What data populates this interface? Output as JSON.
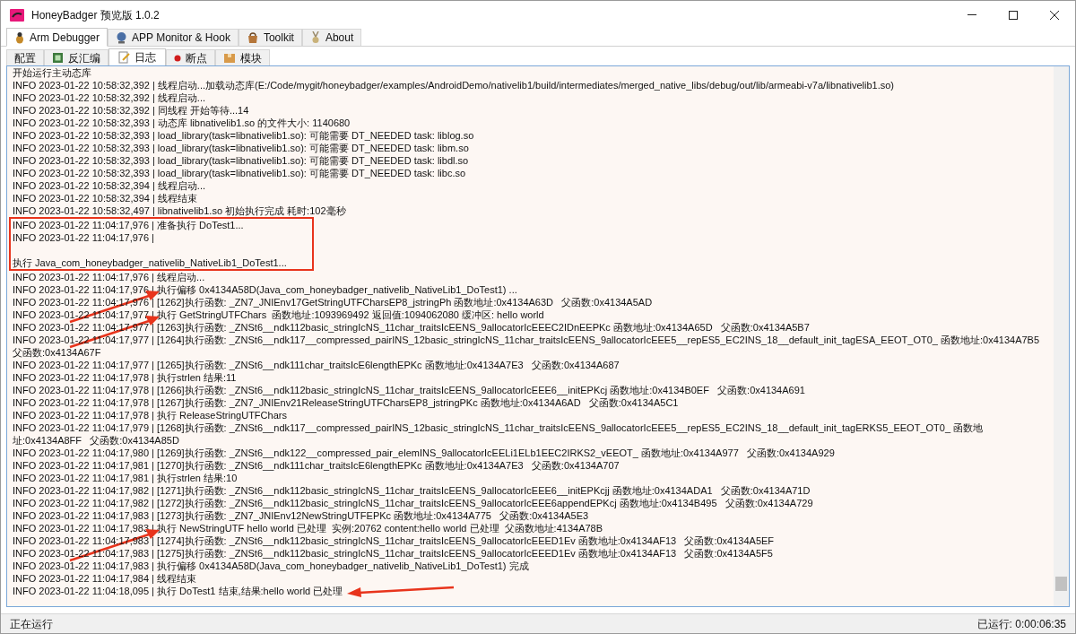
{
  "window": {
    "title": "HoneyBadger 预览版 1.0.2"
  },
  "main_tabs": [
    {
      "label": "Arm Debugger",
      "selected": true
    },
    {
      "label": "APP Monitor & Hook",
      "selected": false
    },
    {
      "label": "Toolkit",
      "selected": false
    },
    {
      "label": "About",
      "selected": false
    }
  ],
  "sub_tabs": [
    {
      "label": "配置",
      "selected": false
    },
    {
      "label": "反汇编",
      "selected": false
    },
    {
      "label": "日志",
      "selected": true
    },
    {
      "label": "断点",
      "selected": false
    },
    {
      "label": "模块",
      "selected": false
    }
  ],
  "log": [
    {
      "text": "开始运行主动态库",
      "highlighted": false,
      "arrow_from_left": false,
      "arrow_from_right": false
    },
    {
      "text": "INFO 2023-01-22 10:58:32,392 | 线程启动...加载动态库(E:/Code/mygit/honeybadger/examples/AndroidDemo/nativelib1/build/intermediates/merged_native_libs/debug/out/lib/armeabi-v7a/libnativelib1.so)",
      "highlighted": false,
      "arrow_from_left": false,
      "arrow_from_right": false
    },
    {
      "text": "INFO 2023-01-22 10:58:32,392 | 线程启动...",
      "highlighted": false,
      "arrow_from_left": false,
      "arrow_from_right": false
    },
    {
      "text": "INFO 2023-01-22 10:58:32,392 | 同线程 开始等待...14",
      "highlighted": false,
      "arrow_from_left": false,
      "arrow_from_right": false
    },
    {
      "text": "INFO 2023-01-22 10:58:32,393 | 动态库 libnativelib1.so 的文件大小: 1140680",
      "highlighted": false,
      "arrow_from_left": false,
      "arrow_from_right": false
    },
    {
      "text": "INFO 2023-01-22 10:58:32,393 | load_library(task=libnativelib1.so): 可能需要 DT_NEEDED task: liblog.so",
      "highlighted": false,
      "arrow_from_left": false,
      "arrow_from_right": false
    },
    {
      "text": "INFO 2023-01-22 10:58:32,393 | load_library(task=libnativelib1.so): 可能需要 DT_NEEDED task: libm.so",
      "highlighted": false,
      "arrow_from_left": false,
      "arrow_from_right": false
    },
    {
      "text": "INFO 2023-01-22 10:58:32,393 | load_library(task=libnativelib1.so): 可能需要 DT_NEEDED task: libdl.so",
      "highlighted": false,
      "arrow_from_left": false,
      "arrow_from_right": false
    },
    {
      "text": "INFO 2023-01-22 10:58:32,393 | load_library(task=libnativelib1.so): 可能需要 DT_NEEDED task: libc.so",
      "highlighted": false,
      "arrow_from_left": false,
      "arrow_from_right": false
    },
    {
      "text": "INFO 2023-01-22 10:58:32,394 | 线程启动...",
      "highlighted": false,
      "arrow_from_left": false,
      "arrow_from_right": false
    },
    {
      "text": "INFO 2023-01-22 10:58:32,394 | 线程结束",
      "highlighted": false,
      "arrow_from_left": false,
      "arrow_from_right": false
    },
    {
      "text": "INFO 2023-01-22 10:58:32,497 | libnativelib1.so 初始执行完成 耗时:102毫秒",
      "highlighted": false,
      "arrow_from_left": false,
      "arrow_from_right": false
    },
    {
      "text": "INFO 2023-01-22 11:04:17,976 | 准备执行 DoTest1...",
      "highlighted": true,
      "arrow_from_left": false,
      "arrow_from_right": false
    },
    {
      "text": "INFO 2023-01-22 11:04:17,976 |\n\n执行 Java_com_honeybadger_nativelib_NativeLib1_DoTest1...",
      "highlighted": true,
      "arrow_from_left": false,
      "arrow_from_right": false
    },
    {
      "text": "INFO 2023-01-22 11:04:17,976 | 线程启动...",
      "highlighted": false,
      "arrow_from_left": false,
      "arrow_from_right": false
    },
    {
      "text": "INFO 2023-01-22 11:04:17,976 | 执行偏移 0x4134A58D(Java_com_honeybadger_nativelib_NativeLib1_DoTest1) ...",
      "highlighted": false,
      "arrow_from_left": true,
      "arrow_from_right": false
    },
    {
      "text": "INFO 2023-01-22 11:04:17,976 | [1262]执行函数: _ZN7_JNIEnv17GetStringUTFCharsEP8_jstringPh 函数地址:0x4134A63D   父函数:0x4134A5AD",
      "highlighted": false,
      "arrow_from_left": false,
      "arrow_from_right": false
    },
    {
      "text": "INFO 2023-01-22 11:04:17,977 | 执行 GetStringUTFChars  函数地址:1093969492 返回值:1094062080 缓冲区: hello world",
      "highlighted": false,
      "arrow_from_left": true,
      "arrow_from_right": false
    },
    {
      "text": "INFO 2023-01-22 11:04:17,977 | [1263]执行函数: _ZNSt6__ndk112basic_stringIcNS_11char_traitsIcEENS_9allocatorIcEEEC2IDnEEPKc 函数地址:0x4134A65D   父函数:0x4134A5B7",
      "highlighted": false,
      "arrow_from_left": false,
      "arrow_from_right": false
    },
    {
      "text": "INFO 2023-01-22 11:04:17,977 | [1264]执行函数: _ZNSt6__ndk117__compressed_pairINS_12basic_stringIcNS_11char_traitsIcEENS_9allocatorIcEEE5__repES5_EC2INS_18__default_init_tagESA_EEOT_OT0_ 函数地址:0x4134A7B5   父函数:0x4134A67F",
      "highlighted": false,
      "arrow_from_left": false,
      "arrow_from_right": false
    },
    {
      "text": "INFO 2023-01-22 11:04:17,977 | [1265]执行函数: _ZNSt6__ndk111char_traitsIcE6lengthEPKc 函数地址:0x4134A7E3   父函数:0x4134A687",
      "highlighted": false,
      "arrow_from_left": false,
      "arrow_from_right": false
    },
    {
      "text": "INFO 2023-01-22 11:04:17,978 | 执行strlen 结果:11",
      "highlighted": false,
      "arrow_from_left": false,
      "arrow_from_right": false
    },
    {
      "text": "INFO 2023-01-22 11:04:17,978 | [1266]执行函数: _ZNSt6__ndk112basic_stringIcNS_11char_traitsIcEENS_9allocatorIcEEE6__initEPKcj 函数地址:0x4134B0EF   父函数:0x4134A691",
      "highlighted": false,
      "arrow_from_left": false,
      "arrow_from_right": false
    },
    {
      "text": "INFO 2023-01-22 11:04:17,978 | [1267]执行函数: _ZN7_JNIEnv21ReleaseStringUTFCharsEP8_jstringPKc 函数地址:0x4134A6AD   父函数:0x4134A5C1",
      "highlighted": false,
      "arrow_from_left": false,
      "arrow_from_right": false
    },
    {
      "text": "INFO 2023-01-22 11:04:17,978 | 执行 ReleaseStringUTFChars",
      "highlighted": false,
      "arrow_from_left": false,
      "arrow_from_right": false
    },
    {
      "text": "INFO 2023-01-22 11:04:17,979 | [1268]执行函数: _ZNSt6__ndk117__compressed_pairINS_12basic_stringIcNS_11char_traitsIcEENS_9allocatorIcEEE5__repES5_EC2INS_18__default_init_tagERKS5_EEOT_OT0_ 函数地址:0x4134A8FF   父函数:0x4134A85D",
      "highlighted": false,
      "arrow_from_left": false,
      "arrow_from_right": false
    },
    {
      "text": "INFO 2023-01-22 11:04:17,980 | [1269]执行函数: _ZNSt6__ndk122__compressed_pair_elemINS_9allocatorIcEELi1ELb1EEC2IRKS2_vEEOT_ 函数地址:0x4134A977   父函数:0x4134A929",
      "highlighted": false,
      "arrow_from_left": false,
      "arrow_from_right": false
    },
    {
      "text": "INFO 2023-01-22 11:04:17,981 | [1270]执行函数: _ZNSt6__ndk111char_traitsIcE6lengthEPKc 函数地址:0x4134A7E3   父函数:0x4134A707",
      "highlighted": false,
      "arrow_from_left": false,
      "arrow_from_right": false
    },
    {
      "text": "INFO 2023-01-22 11:04:17,981 | 执行strlen 结果:10",
      "highlighted": false,
      "arrow_from_left": false,
      "arrow_from_right": false
    },
    {
      "text": "INFO 2023-01-22 11:04:17,982 | [1271]执行函数: _ZNSt6__ndk112basic_stringIcNS_11char_traitsIcEENS_9allocatorIcEEE6__initEPKcjj 函数地址:0x4134ADA1   父函数:0x4134A71D",
      "highlighted": false,
      "arrow_from_left": false,
      "arrow_from_right": false
    },
    {
      "text": "INFO 2023-01-22 11:04:17,982 | [1272]执行函数: _ZNSt6__ndk112basic_stringIcNS_11char_traitsIcEENS_9allocatorIcEEE6appendEPKcj 函数地址:0x4134B495   父函数:0x4134A729",
      "highlighted": false,
      "arrow_from_left": false,
      "arrow_from_right": false
    },
    {
      "text": "INFO 2023-01-22 11:04:17,983 | [1273]执行函数: _ZN7_JNIEnv12NewStringUTFEPKc 函数地址:0x4134A775   父函数:0x4134A5E3",
      "highlighted": false,
      "arrow_from_left": false,
      "arrow_from_right": false
    },
    {
      "text": "INFO 2023-01-22 11:04:17,983 | 执行 NewStringUTF hello world 已处理  实例:20762 content:hello world 已处理  父函数地址:4134A78B",
      "highlighted": false,
      "arrow_from_left": true,
      "arrow_from_right": false
    },
    {
      "text": "INFO 2023-01-22 11:04:17,983 | [1274]执行函数: _ZNSt6__ndk112basic_stringIcNS_11char_traitsIcEENS_9allocatorIcEEED1Ev 函数地址:0x4134AF13   父函数:0x4134A5EF",
      "highlighted": false,
      "arrow_from_left": false,
      "arrow_from_right": false
    },
    {
      "text": "INFO 2023-01-22 11:04:17,983 | [1275]执行函数: _ZNSt6__ndk112basic_stringIcNS_11char_traitsIcEENS_9allocatorIcEEED1Ev 函数地址:0x4134AF13   父函数:0x4134A5F5",
      "highlighted": false,
      "arrow_from_left": false,
      "arrow_from_right": false
    },
    {
      "text": "INFO 2023-01-22 11:04:17,983 | 执行偏移 0x4134A58D(Java_com_honeybadger_nativelib_NativeLib1_DoTest1) 完成",
      "highlighted": false,
      "arrow_from_left": false,
      "arrow_from_right": false
    },
    {
      "text": "INFO 2023-01-22 11:04:17,984 | 线程结束",
      "highlighted": false,
      "arrow_from_left": false,
      "arrow_from_right": false
    },
    {
      "text": "INFO 2023-01-22 11:04:18,095 | 执行 DoTest1 结束,结果:hello world 已处理",
      "highlighted": false,
      "arrow_from_left": false,
      "arrow_from_right": true
    }
  ],
  "status_bar": {
    "left": "正在运行",
    "right": "已运行: 0:00:06:35"
  }
}
